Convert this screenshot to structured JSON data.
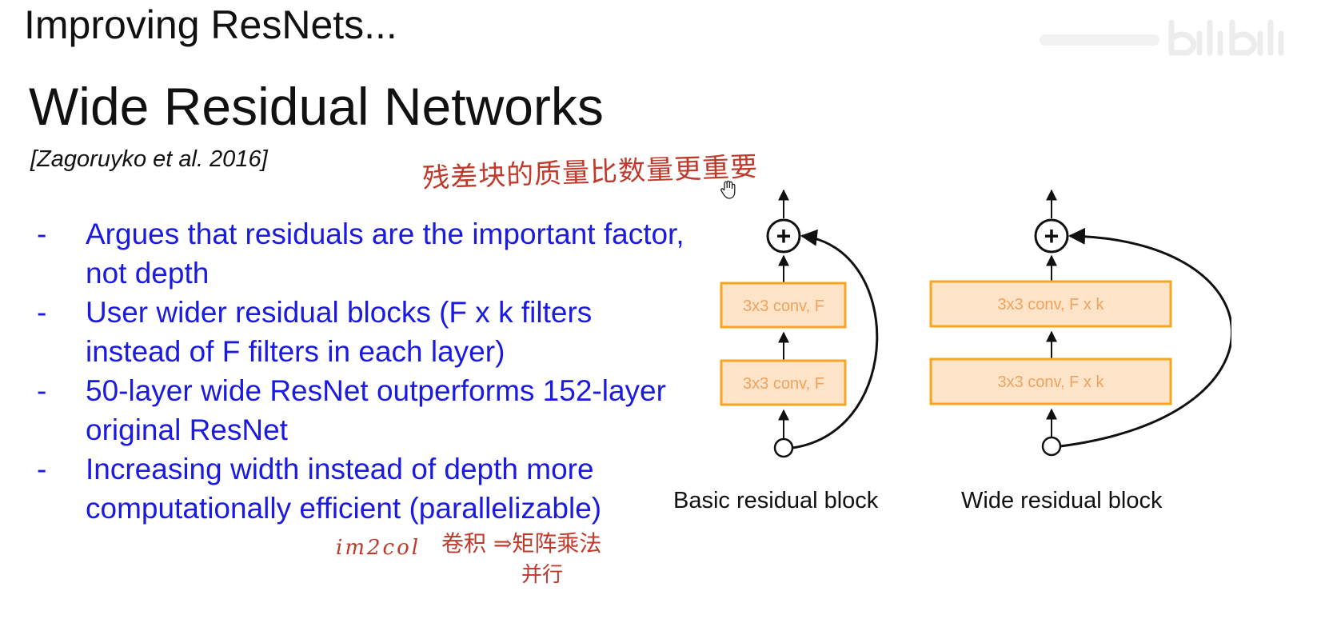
{
  "slide": {
    "heading": "Improving ResNets...",
    "title": "Wide Residual Networks",
    "citation": "[Zagoruyko et al. 2016]"
  },
  "bullets": [
    {
      "marker": "-",
      "text": "Argues that residuals are the important factor, not depth"
    },
    {
      "marker": "-",
      "text": "User wider residual blocks (F x k filters instead of F filters in each layer)"
    },
    {
      "marker": "-",
      "text": "50-layer wide ResNet outperforms 152-layer original ResNet"
    },
    {
      "marker": "-",
      "text": "Increasing width instead of depth more computationally efficient (parallelizable)"
    }
  ],
  "annotations": {
    "top_note": "残差块的质量比数量更重要",
    "im2col": "im2col",
    "conv_to_matmul": "卷积 ⇒矩阵乘法",
    "parallel": "并行"
  },
  "diagram": {
    "basic_block": {
      "caption": "Basic residual block",
      "conv_top": "3x3 conv, F",
      "conv_bottom": "3x3 conv, F",
      "add_symbol": "+"
    },
    "wide_block": {
      "caption": "Wide residual block",
      "conv_top": "3x3 conv, F x k",
      "conv_bottom": "3x3 conv, F x k",
      "add_symbol": "+"
    },
    "colors": {
      "box_fill": "#fde3c8",
      "box_stroke": "#f5a623",
      "box_text": "#f0a35e",
      "line": "#111111"
    }
  },
  "colors": {
    "bullet_text": "#1a1ae0",
    "handwriting": "#c0392b",
    "body_text": "#111111"
  }
}
